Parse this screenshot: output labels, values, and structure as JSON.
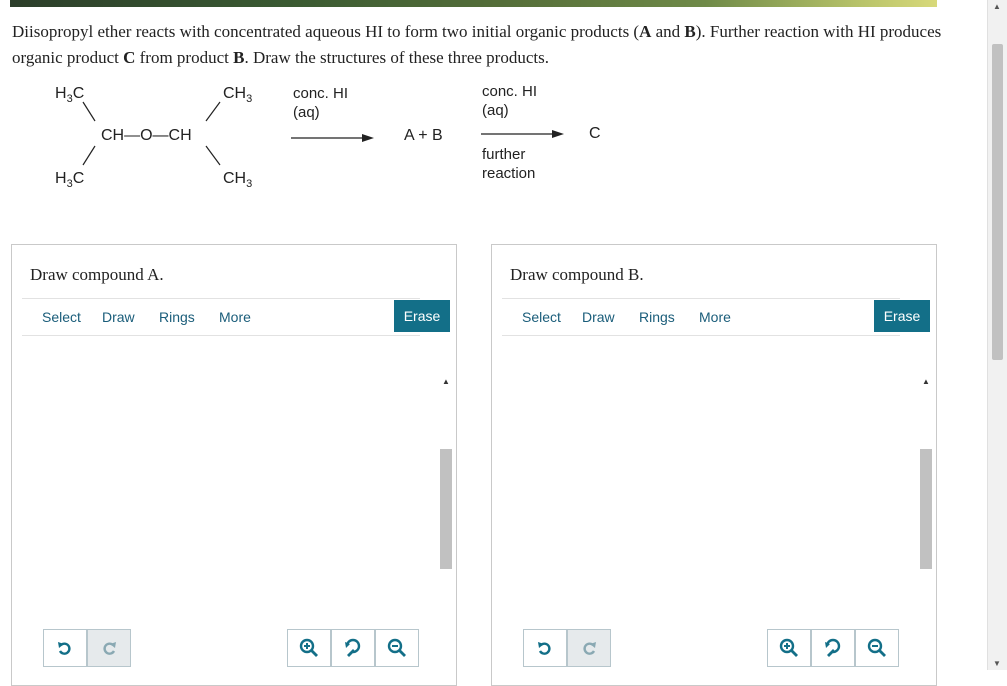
{
  "question": {
    "part1": "Diisopropyl ether reacts with concentrated aqueous HI to form two initial organic products (",
    "A": "A",
    "and": " and ",
    "B": "B",
    "part2": "). Further reaction with HI produces organic product ",
    "C": "C",
    "part3": " from product ",
    "B2": "B",
    "part4": ". Draw the structures of these three products."
  },
  "reaction": {
    "h3c": "H",
    "ch3": "CH",
    "sub3": "3",
    "chain": "CH—O—CH",
    "reagent1_line1": "conc. HI",
    "reagent1_line2": "(aq)",
    "intermediate": "A + B",
    "reagent2_line1": "conc. HI",
    "reagent2_line2": "(aq)",
    "product": "C",
    "condition_line1": "further",
    "condition_line2": "reaction"
  },
  "panels": [
    {
      "title": "Draw compound A.",
      "tools": [
        "Select",
        "Draw",
        "Rings",
        "More"
      ],
      "erase": "Erase"
    },
    {
      "title": "Draw compound B.",
      "tools": [
        "Select",
        "Draw",
        "Rings",
        "More"
      ],
      "erase": "Erase"
    }
  ],
  "icons": {
    "undo": "undo-icon",
    "redo": "redo-icon",
    "zoom_in": "zoom-in-icon",
    "reset_zoom": "reset-zoom-icon",
    "zoom_out": "zoom-out-icon"
  },
  "colors": {
    "accent": "#136f88",
    "link": "#1a5d7a",
    "panel_border": "#c9c9c9"
  }
}
